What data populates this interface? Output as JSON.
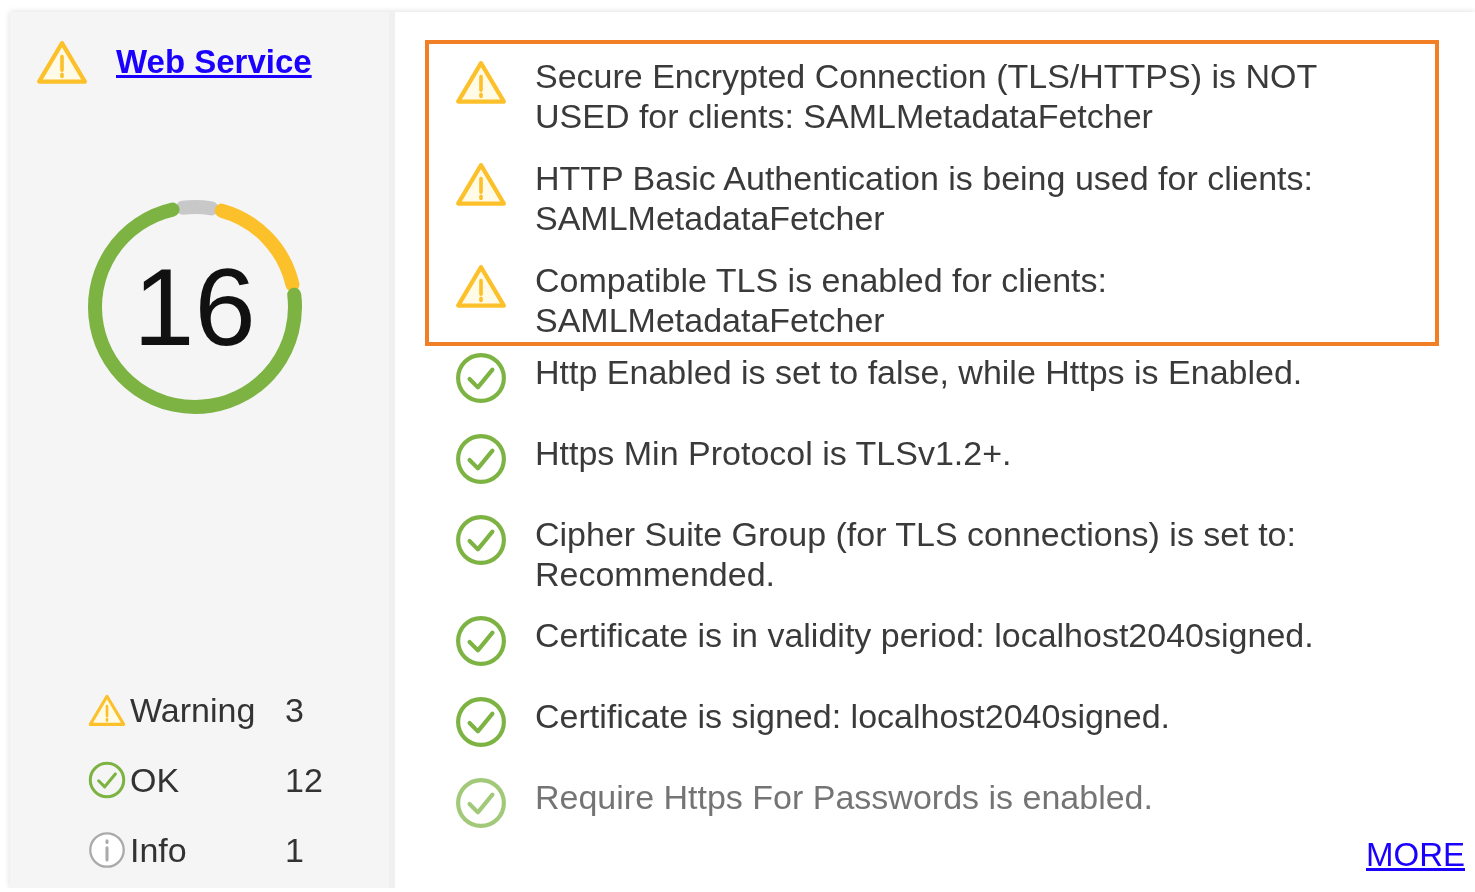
{
  "service": {
    "title": "Web Service",
    "kind": "warning"
  },
  "score": {
    "total": "16"
  },
  "legend": [
    {
      "kind": "warning",
      "label": "Warning",
      "count": "3"
    },
    {
      "kind": "ok",
      "label": "OK",
      "count": "12"
    },
    {
      "kind": "info",
      "label": "Info",
      "count": "1"
    }
  ],
  "checks": [
    {
      "kind": "warning",
      "highlighted": true,
      "text": "Secure Encrypted Connection (TLS/HTTPS) is NOT USED for clients: SAMLMetadataFetcher"
    },
    {
      "kind": "warning",
      "highlighted": true,
      "text": "HTTP Basic Authentication is being used for clients: SAMLMetadataFetcher"
    },
    {
      "kind": "warning",
      "highlighted": true,
      "text": "Compatible TLS is enabled for clients: SAMLMetadataFetcher"
    },
    {
      "kind": "ok",
      "highlighted": false,
      "text": "Http Enabled is set to false, while Https is Enabled."
    },
    {
      "kind": "ok",
      "highlighted": false,
      "text": "Https Min Protocol is TLSv1.2+."
    },
    {
      "kind": "ok",
      "highlighted": false,
      "text": "Cipher Suite Group (for TLS connections) is set to: Recommended."
    },
    {
      "kind": "ok",
      "highlighted": false,
      "text": "Certificate is in validity period: localhost2040signed."
    },
    {
      "kind": "ok",
      "highlighted": false,
      "text": "Certificate is signed: localhost2040signed."
    },
    {
      "kind": "ok",
      "highlighted": false,
      "text": "Require Https For Passwords is enabled."
    }
  ],
  "more_link": "MORE"
}
